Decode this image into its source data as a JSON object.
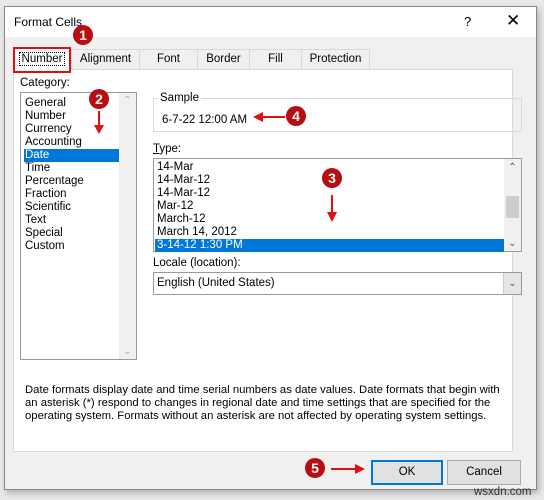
{
  "window": {
    "title": "Format Cells",
    "help_label": "?",
    "close_label": "✕"
  },
  "tabs": [
    {
      "label": "Number",
      "active": true
    },
    {
      "label": "Alignment",
      "active": false
    },
    {
      "label": "Font",
      "active": false
    },
    {
      "label": "Border",
      "active": false
    },
    {
      "label": "Fill",
      "active": false
    },
    {
      "label": "Protection",
      "active": false
    }
  ],
  "category": {
    "label": "Category:",
    "items": [
      "General",
      "Number",
      "Currency",
      "Accounting",
      "Date",
      "Time",
      "Percentage",
      "Fraction",
      "Scientific",
      "Text",
      "Special",
      "Custom"
    ],
    "selected": "Date"
  },
  "sample": {
    "label": "Sample",
    "value": "6-7-22 12:00 AM"
  },
  "type": {
    "label": "Type:",
    "items": [
      "14-Mar",
      "14-Mar-12",
      "14-Mar-12",
      "Mar-12",
      "March-12",
      "March 14, 2012",
      "3-14-12 1:30 PM"
    ],
    "selected": "3-14-12 1:30 PM"
  },
  "locale": {
    "label": "Locale (location):",
    "value": "English (United States)"
  },
  "description": "Date formats display date and time serial numbers as date values.  Date formats that begin with an asterisk (*) respond to changes in regional date and time settings that are specified for the operating system. Formats without an asterisk are not affected by operating system settings.",
  "buttons": {
    "ok": "OK",
    "cancel": "Cancel"
  },
  "annotations": [
    "1",
    "2",
    "3",
    "4",
    "5"
  ],
  "watermark": "wsxdn.com",
  "colors": {
    "selection": "#0078d7",
    "annotation": "#b80d12",
    "highlight_border": "#e01010"
  }
}
